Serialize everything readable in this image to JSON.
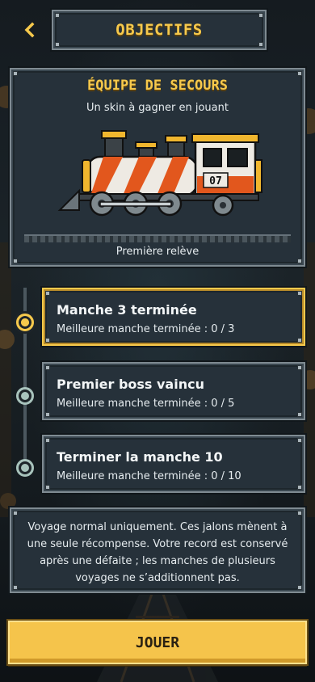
{
  "header": {
    "back_icon": "chevron-left-icon",
    "title": "OBJECTIFS"
  },
  "reward": {
    "title": "ÉQUIPE DE SECOURS",
    "subtitle": "Un skin à gagner en jouant",
    "locomotive_number": "07",
    "caption": "Première relève"
  },
  "milestones": [
    {
      "title": "Manche 3 terminée",
      "progress": "Meilleure manche terminée : 0 / 3",
      "active": true
    },
    {
      "title": "Premier boss vaincu",
      "progress": "Meilleure manche terminée : 0 / 5",
      "active": false
    },
    {
      "title": "Terminer la manche 10",
      "progress": "Meilleure manche terminée : 0 / 10",
      "active": false
    }
  ],
  "info": {
    "text": "Voyage normal uniquement. Ces jalons mènent à une seule récompense. Votre record est conservé après une défaite ; les manches de plusieurs voyages ne s’additionnent pas."
  },
  "play_button": {
    "label": "JOUER"
  },
  "colors": {
    "accent": "#f6c94c",
    "panel": "#26313a",
    "panel_border": "#7f8b92",
    "node_idle": "#a8c3bc"
  }
}
